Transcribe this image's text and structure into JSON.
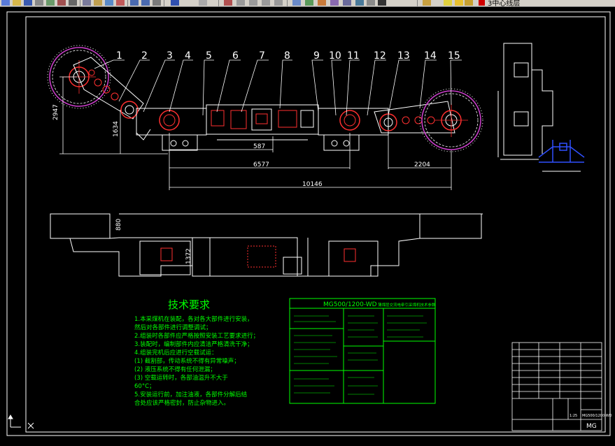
{
  "toolbar": {
    "layer_name": "3中心线层"
  },
  "drawing": {
    "part_numbers": [
      "1",
      "2",
      "3",
      "4",
      "5",
      "6",
      "7",
      "8",
      "9",
      "10",
      "11",
      "12",
      "13",
      "14",
      "15"
    ],
    "dimensions": {
      "d2947": "2947",
      "d1634": "1634",
      "d587": "587",
      "d6577": "6577",
      "d2204": "2204",
      "d10146": "10146",
      "d880": "880",
      "d1372": "1372"
    },
    "tech_req_title": "技术要求",
    "tech_req_lines": [
      "1.本采煤机在装配，各对各大部件进行安装，",
      "  然后对各部件进行调整调试；",
      "2.组装时各部件应严格按照安装工艺要求进行；",
      "3.装配时，编制部件内应清洁严格清洗干净；",
      "4.组装完机后应进行空载试运：",
      "  (1) 截割部，传动系统不得有异常噪声；",
      "  (2) 液压系统不得有任何泄漏；",
      "  (3) 空载运转时，各部油温升不大于",
      "      60°C；",
      "5.安装运行前，加注油液，各部件分解后结",
      "  合处应该严格密封，防止杂物进入。"
    ],
    "spec_table_title": "MG500/1200-WD",
    "spec_table_subtitle": "薄煤层交流电牵引采煤机技术参数",
    "title_block_code": "MG500/1200-WD",
    "title_block_mg": "MG",
    "title_block_scale": "1:25"
  }
}
